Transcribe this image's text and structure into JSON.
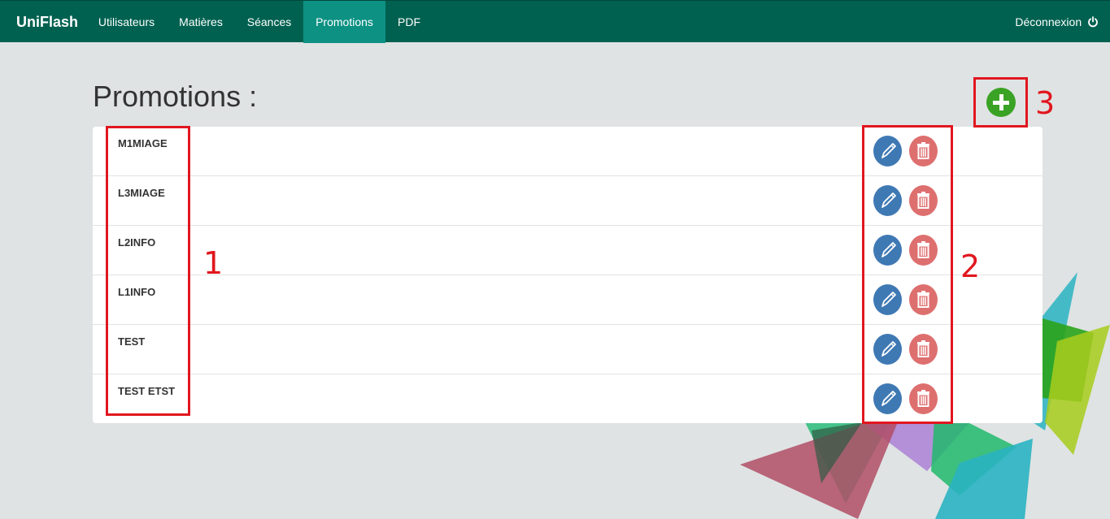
{
  "navbar": {
    "brand": "UniFlash",
    "items": [
      {
        "label": "Utilisateurs"
      },
      {
        "label": "Matières"
      },
      {
        "label": "Séances"
      },
      {
        "label": "Promotions"
      },
      {
        "label": "PDF"
      }
    ],
    "active_item": "Promotions",
    "logout_label": "Déconnexion",
    "logout_icon": "power-icon"
  },
  "page": {
    "title": "Promotions :",
    "add_icon": "plus-circle-icon"
  },
  "promotions": [
    {
      "name": "M1MIAGE"
    },
    {
      "name": "L3MIAGE"
    },
    {
      "name": "L2INFO"
    },
    {
      "name": "L1INFO"
    },
    {
      "name": "TEST"
    },
    {
      "name": "TEST ETST"
    }
  ],
  "row_actions": {
    "edit_icon": "pencil-icon",
    "delete_icon": "trash-icon"
  },
  "annotations": [
    {
      "number": "1"
    },
    {
      "number": "2"
    },
    {
      "number": "3"
    }
  ],
  "colors": {
    "navbar": "#006150",
    "nav_active": "#0c9183",
    "background": "#dfe3e3",
    "edit": "#3f79b4",
    "delete": "#de6f6f",
    "add": "#3aa224",
    "annotation": "#e1171f"
  }
}
